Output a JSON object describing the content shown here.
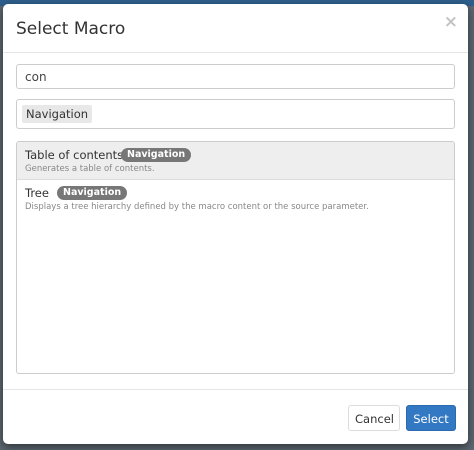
{
  "dialog": {
    "title": "Select Macro",
    "close_glyph": "×"
  },
  "search": {
    "value": "con",
    "placeholder": ""
  },
  "category_filter": {
    "selected": "Navigation"
  },
  "results": [
    {
      "name": "Table of contents",
      "category": "Navigation",
      "description": "Generates a table of contents.",
      "selected": true
    },
    {
      "name": "Tree",
      "category": "Navigation",
      "description": "Displays a tree hierarchy defined by the macro content or the source parameter.",
      "selected": false
    }
  ],
  "footer": {
    "cancel_label": "Cancel",
    "select_label": "Select"
  },
  "colors": {
    "primary": "#3378c2",
    "badge": "#777777",
    "selected_row": "#eeeeee"
  },
  "icons": {
    "close": "close-icon"
  }
}
